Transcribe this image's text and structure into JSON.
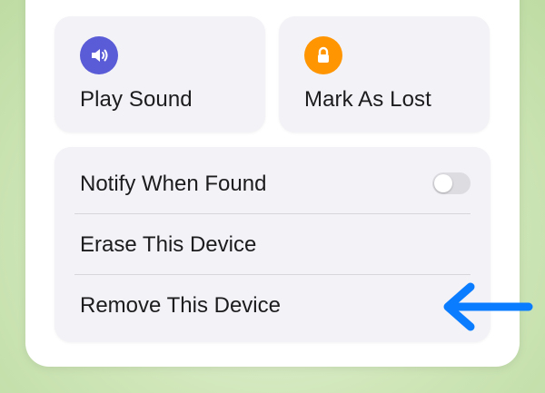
{
  "actions": {
    "play_sound": {
      "label": "Play Sound",
      "icon": "speaker-icon",
      "icon_color": "#5a5bd6"
    },
    "mark_as_lost": {
      "label": "Mark As Lost",
      "icon": "lock-icon",
      "icon_color": "#ff9500"
    }
  },
  "options": {
    "notify_when_found": {
      "label": "Notify When Found",
      "toggle_on": false
    },
    "erase_device": {
      "label": "Erase This Device"
    },
    "remove_device": {
      "label": "Remove This Device"
    }
  },
  "annotation": {
    "arrow_color": "#0a7cff",
    "points_to": "Remove This Device"
  }
}
